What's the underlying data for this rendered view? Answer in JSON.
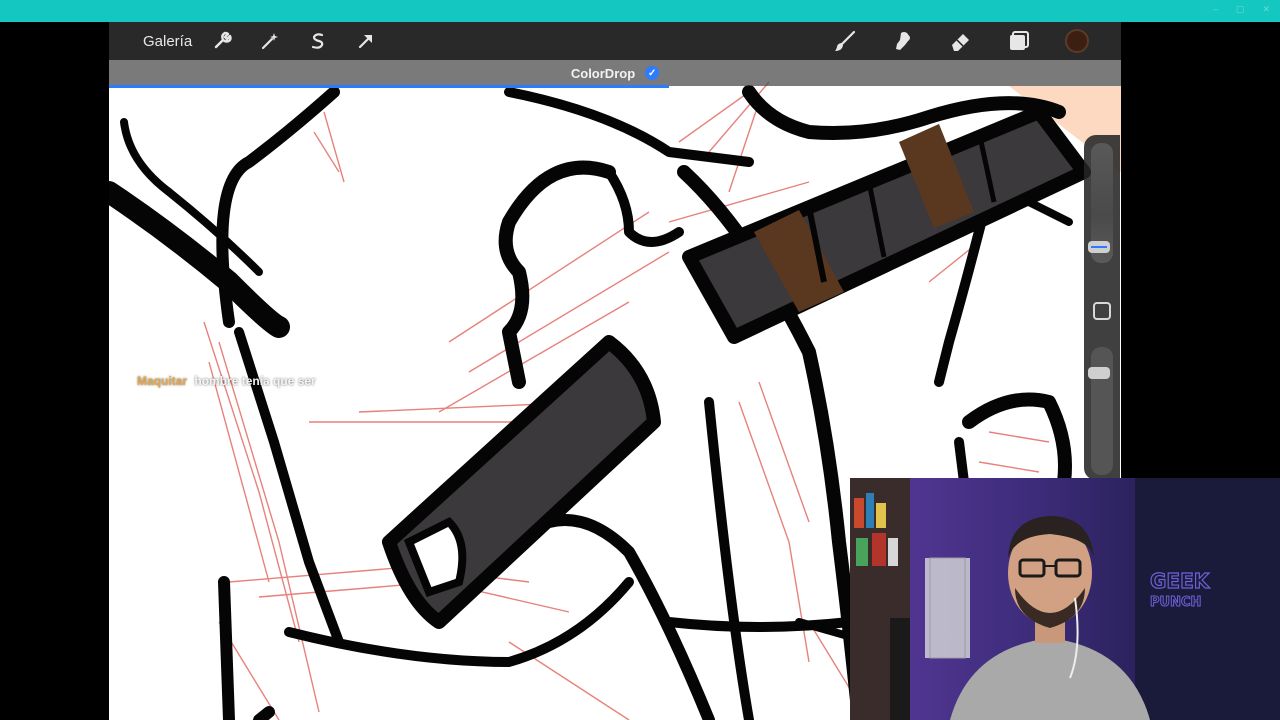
{
  "window": {
    "controls": [
      "–",
      "▢",
      "✕"
    ]
  },
  "toolbar": {
    "gallery_label": "Galería",
    "left_tools": [
      {
        "name": "wrench-icon"
      },
      {
        "name": "magic-wand-icon"
      },
      {
        "name": "selection-icon"
      },
      {
        "name": "transform-icon"
      }
    ],
    "right_tools": [
      {
        "name": "brush-icon"
      },
      {
        "name": "smudge-icon"
      },
      {
        "name": "eraser-icon"
      },
      {
        "name": "layers-icon"
      }
    ],
    "current_color": "#3d1f12"
  },
  "notification": {
    "label": "ColorDrop",
    "checked": true
  },
  "sidebar": {
    "brush_size_level": 0.85,
    "opacity_level": 0.15
  },
  "subtitle": {
    "speaker": "Maquitar",
    "text": "hombre tenía que ser"
  },
  "webcam": {
    "poster_text": "GEEK PUNCH"
  },
  "colors": {
    "accent": "#2b7cff",
    "topbar": "#14c7c0",
    "sketch": "#e0574f",
    "ink": "#050505",
    "fill_dark": "#3b393b",
    "fill_brown": "#5a3820"
  }
}
